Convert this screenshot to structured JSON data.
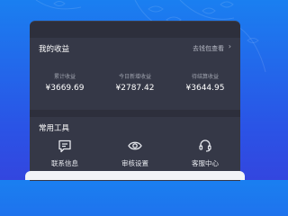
{
  "earnings": {
    "title": "我的收益",
    "wallet_link": "去钱包查看",
    "stats": [
      {
        "label": "累计收益",
        "value": "¥3669.69"
      },
      {
        "label": "今日新增收益",
        "value": "¥2787.42"
      },
      {
        "label": "待结算收益",
        "value": "¥3644.95"
      }
    ]
  },
  "tools": {
    "title": "常用工具",
    "items": [
      {
        "label": "联系信息",
        "icon": "message-icon"
      },
      {
        "label": "审核设置",
        "icon": "eye-icon"
      },
      {
        "label": "客服中心",
        "icon": "headset-icon"
      }
    ]
  },
  "colors": {
    "background_top": "#1a7ff0",
    "background_bottom": "#3346df",
    "panel": "#2d2f3c",
    "card": "#353847"
  }
}
